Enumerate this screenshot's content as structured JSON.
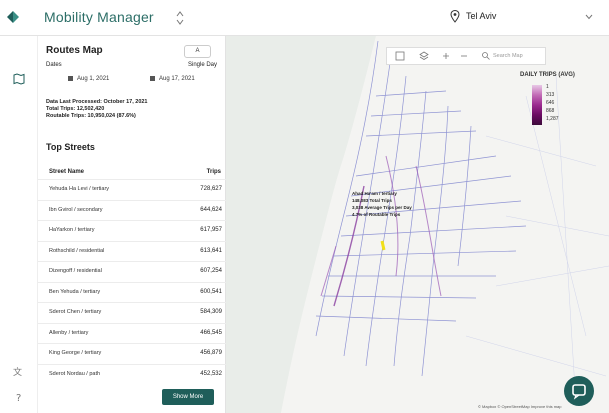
{
  "app": {
    "title": "Mobility Manager",
    "city": "Tel Aviv"
  },
  "panel": {
    "title": "Routes Map",
    "ab_label": "A",
    "dates_label": "Dates",
    "single_day_label": "Single Day",
    "start_date": "Aug 1, 2021",
    "end_date": "Aug 17, 2021",
    "stats": {
      "last_processed": "Data Last Processed: October 17, 2021",
      "total_trips": "Total Trips: 12,502,420",
      "routable_trips": "Routable Trips: 10,950,024 (87.6%)"
    },
    "top_streets_title": "Top Streets",
    "columns": {
      "street": "Street Name",
      "trips": "Trips"
    },
    "rows": [
      {
        "name": "Yehuda Ha Levi / tertiary",
        "trips": "728,627"
      },
      {
        "name": "Ibn Gvirol / secondary",
        "trips": "644,624"
      },
      {
        "name": "HaYarkon / tertiary",
        "trips": "617,957"
      },
      {
        "name": "Rothschild / residential",
        "trips": "613,641"
      },
      {
        "name": "Dizengoff / residential",
        "trips": "607,254"
      },
      {
        "name": "Ben Yehuda / tertiary",
        "trips": "600,541"
      },
      {
        "name": "Sderot Chen / tertiary",
        "trips": "584,309"
      },
      {
        "name": "Allenby / tertiary",
        "trips": "466,545"
      },
      {
        "name": "King George / tertiary",
        "trips": "456,879"
      },
      {
        "name": "Sderot Nordau / path",
        "trips": "452,532"
      }
    ],
    "show_more": "Show More"
  },
  "map": {
    "search_placeholder": "Search Map",
    "legend": {
      "title": "DAILY TRIPS (AVG)",
      "values": [
        "1",
        "313",
        "646",
        "868",
        "1,287"
      ]
    },
    "tooltip": {
      "line1": "Ahad Ha'am / tertiary",
      "line2": "148,083 Total Trips",
      "line3": "3,038 Average Trips per Day",
      "line4": "4.7% of Routable Trips"
    },
    "attribution": "© Mapbox © OpenStreetMap Improve this map"
  }
}
